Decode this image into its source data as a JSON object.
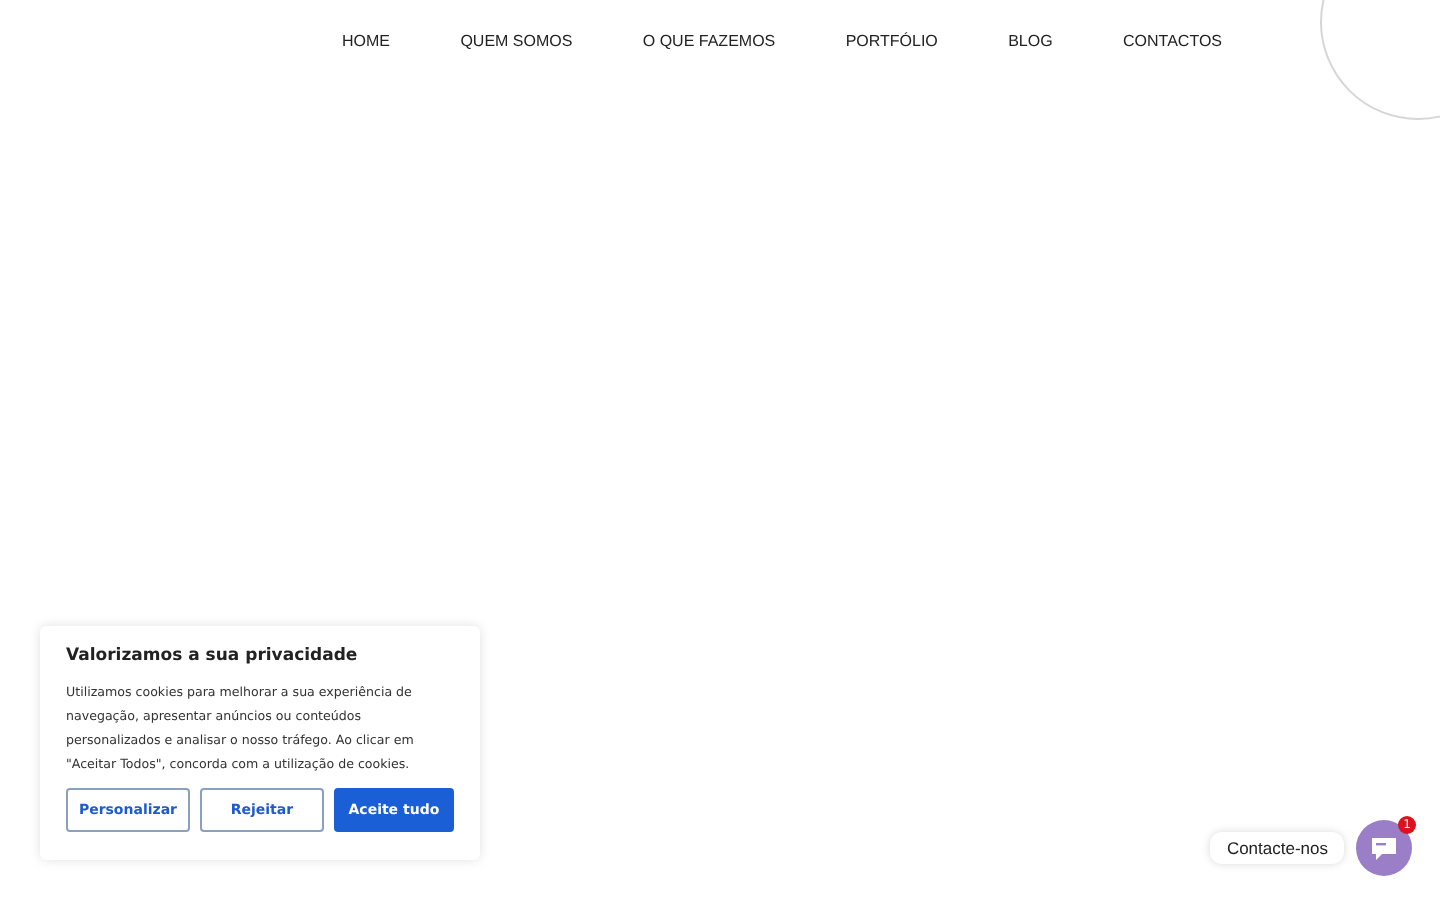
{
  "nav": [
    {
      "label": "HOME"
    },
    {
      "label": "QUEM SOMOS"
    },
    {
      "label": "O QUE FAZEMOS"
    },
    {
      "label": "PORTFÓLIO"
    },
    {
      "label": "BLOG"
    },
    {
      "label": "CONTACTOS"
    }
  ],
  "cookie_banner": {
    "title": "Valorizamos a sua privacidade",
    "text": "Utilizamos cookies para melhorar a sua experiência de navegação, apresentar anúncios ou conteúdos personalizados e analisar o nosso tráfego. Ao clicar em \"Aceitar Todos\", concorda com a utilização de cookies.",
    "buttons": [
      {
        "label": "Personalizar",
        "kind": "outline"
      },
      {
        "label": "Rejeitar",
        "kind": "outline"
      },
      {
        "label": "Aceite tudo",
        "kind": "primary"
      }
    ]
  },
  "chat_widget": {
    "label": "Contacte-nos",
    "badge": "1"
  }
}
